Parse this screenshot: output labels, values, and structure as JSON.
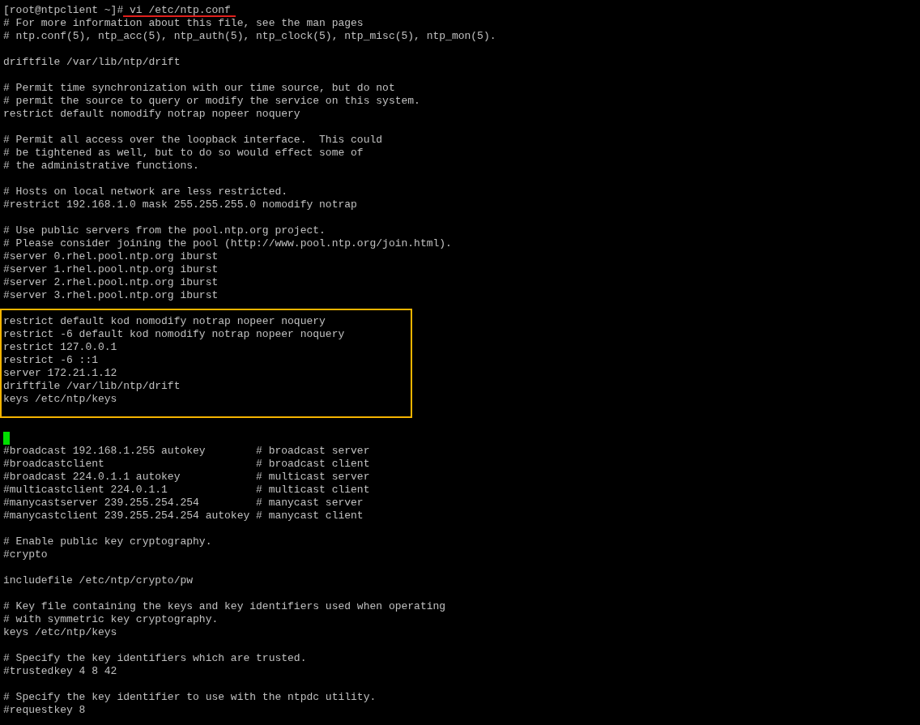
{
  "prompt": {
    "text": "[root@ntpclient ~]#",
    "command": "vi /etc/ntp.conf",
    "underlined": true
  },
  "blocks": [
    {
      "kind": "text",
      "lines": [
        "# For more information about this file, see the man pages",
        "# ntp.conf(5), ntp_acc(5), ntp_auth(5), ntp_clock(5), ntp_misc(5), ntp_mon(5)."
      ]
    },
    {
      "kind": "text",
      "lines": [
        "driftfile /var/lib/ntp/drift"
      ]
    },
    {
      "kind": "text",
      "lines": [
        "# Permit time synchronization with our time source, but do not",
        "# permit the source to query or modify the service on this system.",
        "restrict default nomodify notrap nopeer noquery"
      ]
    },
    {
      "kind": "text",
      "lines": [
        "# Permit all access over the loopback interface.  This could",
        "# be tightened as well, but to do so would effect some of",
        "# the administrative functions."
      ]
    },
    {
      "kind": "text",
      "lines": [
        "# Hosts on local network are less restricted.",
        "#restrict 192.168.1.0 mask 255.255.255.0 nomodify notrap"
      ]
    },
    {
      "kind": "text",
      "lines": [
        "# Use public servers from the pool.ntp.org project.",
        "# Please consider joining the pool (http://www.pool.ntp.org/join.html).",
        "#server 0.rhel.pool.ntp.org iburst",
        "#server 1.rhel.pool.ntp.org iburst",
        "#server 2.rhel.pool.ntp.org iburst",
        "#server 3.rhel.pool.ntp.org iburst"
      ]
    },
    {
      "kind": "highlight",
      "lines": [
        "restrict default kod nomodify notrap nopeer noquery",
        "restrict -6 default kod nomodify notrap nopeer noquery",
        "restrict 127.0.0.1",
        "restrict -6 ::1",
        "server 172.21.1.12",
        "driftfile /var/lib/ntp/drift",
        "keys /etc/ntp/keys"
      ]
    },
    {
      "kind": "cursor"
    },
    {
      "kind": "text",
      "lines": [
        "#broadcast 192.168.1.255 autokey        # broadcast server",
        "#broadcastclient                        # broadcast client",
        "#broadcast 224.0.1.1 autokey            # multicast server",
        "#multicastclient 224.0.1.1              # multicast client",
        "#manycastserver 239.255.254.254         # manycast server",
        "#manycastclient 239.255.254.254 autokey # manycast client"
      ]
    },
    {
      "kind": "text",
      "lines": [
        "# Enable public key cryptography.",
        "#crypto"
      ]
    },
    {
      "kind": "text",
      "lines": [
        "includefile /etc/ntp/crypto/pw"
      ]
    },
    {
      "kind": "text",
      "lines": [
        "# Key file containing the keys and key identifiers used when operating",
        "# with symmetric key cryptography.",
        "keys /etc/ntp/keys"
      ]
    },
    {
      "kind": "text",
      "lines": [
        "# Specify the key identifiers which are trusted.",
        "#trustedkey 4 8 42"
      ]
    },
    {
      "kind": "text",
      "lines": [
        "# Specify the key identifier to use with the ntpdc utility.",
        "#requestkey 8"
      ]
    }
  ]
}
